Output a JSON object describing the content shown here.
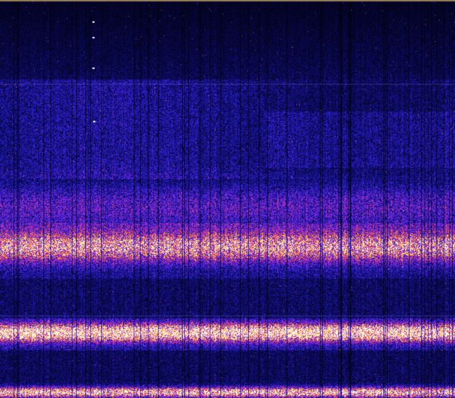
{
  "spectrogram": {
    "colormap": [
      "#000000",
      "#0a0a5a",
      "#2a20d8",
      "#8a2ae0",
      "#e0308a",
      "#ff7a2a",
      "#ffe060",
      "#fffbe0"
    ],
    "background": "#000000",
    "bands": [
      {
        "level": 0.62,
        "intensity": 0.55,
        "spread": 0.035
      },
      {
        "level": 0.835,
        "intensity": 0.85,
        "spread": 0.02
      },
      {
        "level": 0.52,
        "intensity": 0.22,
        "spread": 0.06
      },
      {
        "level": 0.985,
        "intensity": 0.75,
        "spread": 0.012
      }
    ]
  }
}
